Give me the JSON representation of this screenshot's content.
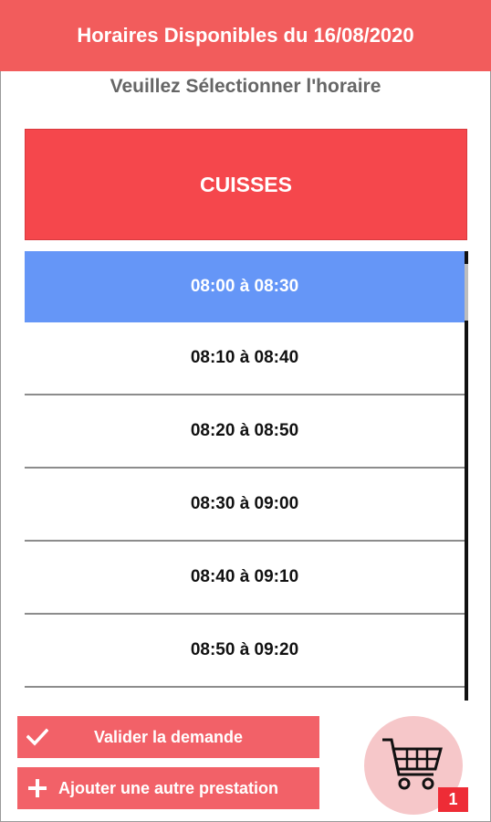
{
  "header": {
    "title": "Horaires Disponibles du 16/08/2020"
  },
  "subtitle": "Veuillez Sélectionner l'horaire",
  "service": {
    "name": "CUISSES"
  },
  "slots": [
    {
      "label": "08:00 à 08:30",
      "selected": true
    },
    {
      "label": "08:10 à 08:40",
      "selected": false
    },
    {
      "label": "08:20 à 08:50",
      "selected": false
    },
    {
      "label": "08:30 à 09:00",
      "selected": false
    },
    {
      "label": "08:40 à 09:10",
      "selected": false
    },
    {
      "label": "08:50 à 09:20",
      "selected": false
    },
    {
      "label": "",
      "selected": false
    }
  ],
  "actions": {
    "validate_label": "Valider la demande",
    "validate_icon": "check-icon",
    "add_label": "Ajouter une autre prestation",
    "add_icon": "plus-icon"
  },
  "cart": {
    "icon": "shopping-cart-icon",
    "count": "1"
  },
  "colors": {
    "header": "#f25c5c",
    "banner": "#f5474c",
    "selected_slot": "#6596f7",
    "button": "#f26168",
    "cart_bg": "#f6c7c9",
    "badge": "#ee2c36"
  }
}
